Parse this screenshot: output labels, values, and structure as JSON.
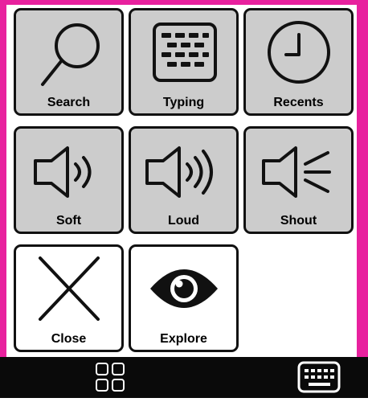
{
  "colors": {
    "frame": "#e8219e",
    "tile_filled": "#cccccc",
    "tile_empty": "#ffffff",
    "stroke": "#111111",
    "bottom_bar": "#0a0a0a",
    "bottom_icon": "#ffffff"
  },
  "tiles": [
    {
      "label": "Search",
      "icon": "magnifier-icon"
    },
    {
      "label": "Typing",
      "icon": "keyboard-icon"
    },
    {
      "label": "Recents",
      "icon": "clock-icon"
    },
    {
      "label": "Soft",
      "icon": "speaker-soft-icon"
    },
    {
      "label": "Loud",
      "icon": "speaker-loud-icon"
    },
    {
      "label": "Shout",
      "icon": "speaker-shout-icon"
    },
    {
      "label": "Close",
      "icon": "close-x-icon"
    },
    {
      "label": "Explore",
      "icon": "eye-icon"
    }
  ],
  "bottom_bar": {
    "left_icon": "grid-icon",
    "right_icon": "keyboard-icon"
  }
}
